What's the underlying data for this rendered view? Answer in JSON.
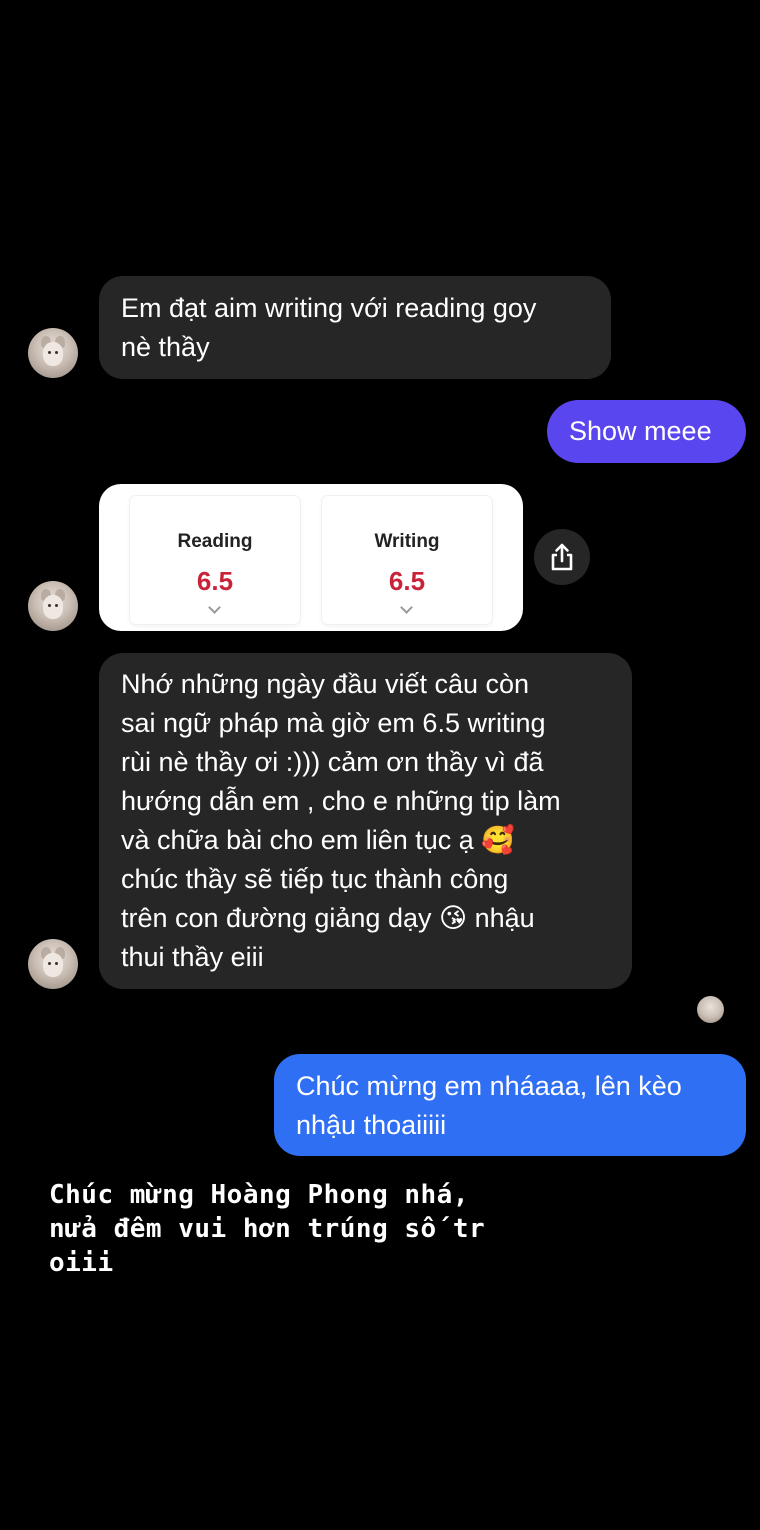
{
  "messages": [
    {
      "sender": "them",
      "text": "Em đạt aim writing với reading goy\nnè thầy"
    },
    {
      "sender": "me",
      "text": "Show meee"
    },
    {
      "sender": "them",
      "type": "score-card",
      "scores": [
        {
          "label": "Reading",
          "value": "6.5"
        },
        {
          "label": "Writing",
          "value": "6.5"
        }
      ]
    },
    {
      "sender": "them",
      "text": "Nhớ những ngày đầu viết câu còn\nsai ngữ pháp mà giờ em 6.5 writing\nrùi nè thầy ơi :))) cảm ơn thầy vì đã\nhướng dẫn em , cho e những tip làm\nvà chữa bài cho em liên tục ạ 🥰\nchúc thầy sẽ tiếp tục thành công\ntrên con đường giảng dạy 😘 nhậu\nthui thầy eiii"
    },
    {
      "sender": "me",
      "text": "Chúc mừng em nháaaa, lên kèo\nnhậu thoaiiiii"
    }
  ],
  "caption": "Chúc mừng Hoàng Phong nhá,\nnửa đêm vui hơn trúng số tr\noiii",
  "icons": {
    "share": "share-icon",
    "avatar": "cat-avatar"
  },
  "colors": {
    "background": "#000000",
    "incoming_bubble": "#262626",
    "outgoing_purple": "#5a46ee",
    "outgoing_blue": "#2f6ff3",
    "score_red": "#c8233a"
  }
}
